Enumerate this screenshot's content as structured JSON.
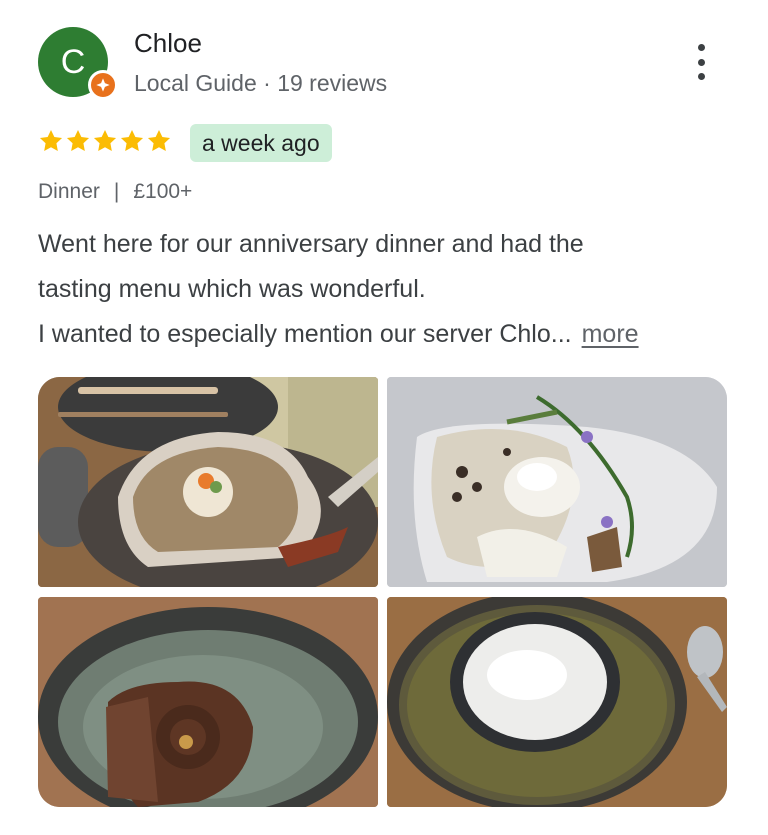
{
  "reviewer": {
    "initial": "C",
    "name": "Chloe",
    "meta": "Local Guide · 19 reviews"
  },
  "rating": {
    "stars": 5,
    "max": 5,
    "star_color": "#fbbc04",
    "date": "a week ago"
  },
  "visit": {
    "meal": "Dinner",
    "separator": "|",
    "price": "£100+"
  },
  "review": {
    "line1": "Went here for our anniversary dinner and had the",
    "line2": "tasting menu which was wonderful.",
    "line3": "I wanted to especially mention our server Chlo...",
    "more_label": "more"
  },
  "colors": {
    "avatar": "#2e7d32",
    "badge": "#e8711c",
    "date_chip": "#cdeed8"
  },
  "icons": {
    "badge": "local-guide-star-icon",
    "menu": "more-vert-icon",
    "star": "star-icon"
  }
}
